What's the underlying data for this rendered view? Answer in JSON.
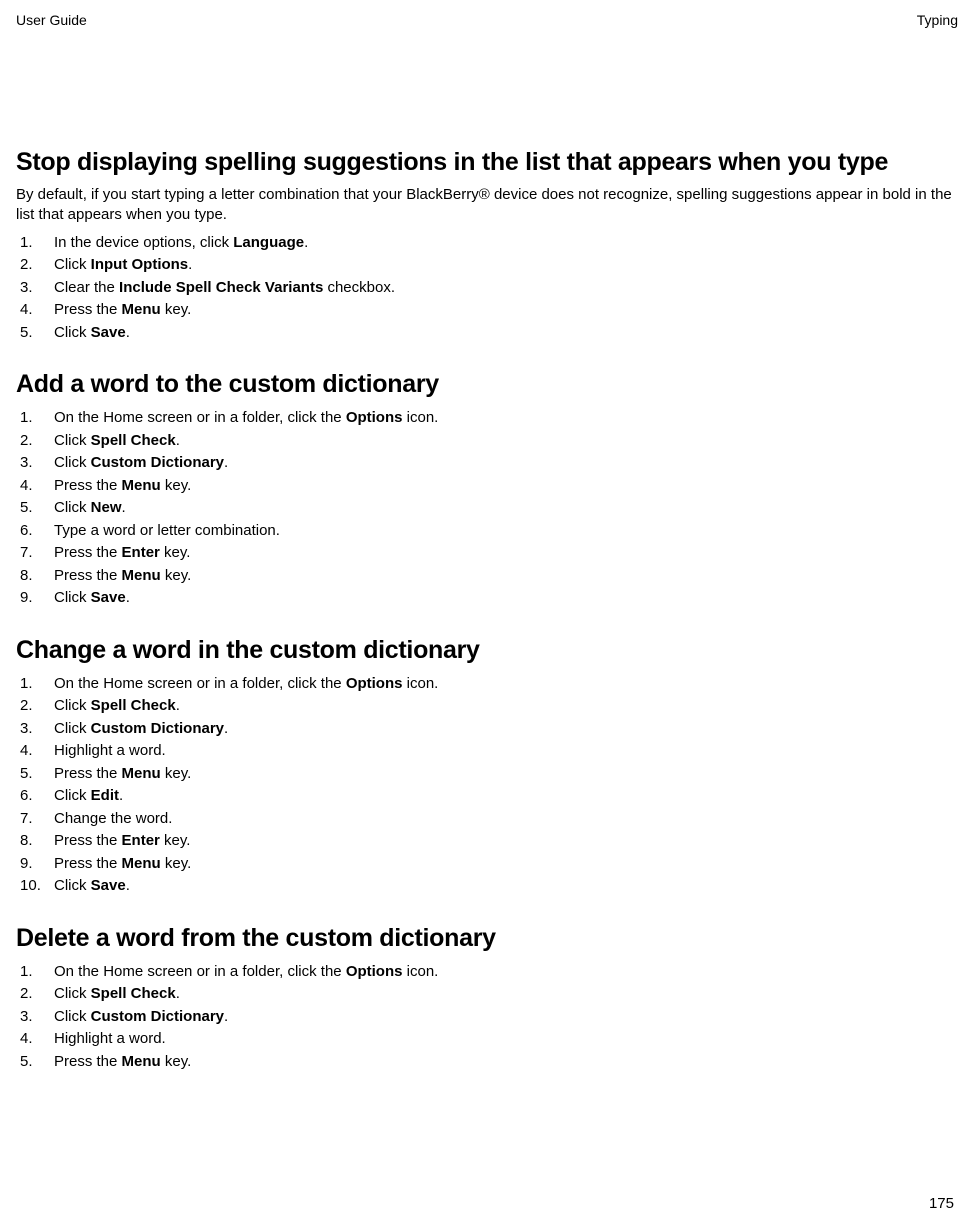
{
  "header": {
    "left": "User Guide",
    "right": "Typing"
  },
  "sections": [
    {
      "title": "Stop displaying spelling suggestions in the list that appears when you type",
      "intro": "By default, if you start typing a letter combination that your BlackBerry® device does not recognize, spelling suggestions appear in bold in the list that appears when you type.",
      "steps": [
        [
          {
            "t": "In the device options, click "
          },
          {
            "b": "Language"
          },
          {
            "t": "."
          }
        ],
        [
          {
            "t": "Click "
          },
          {
            "b": "Input Options"
          },
          {
            "t": "."
          }
        ],
        [
          {
            "t": "Clear the "
          },
          {
            "b": "Include Spell Check Variants"
          },
          {
            "t": " checkbox."
          }
        ],
        [
          {
            "t": "Press the "
          },
          {
            "b": "Menu"
          },
          {
            "t": " key."
          }
        ],
        [
          {
            "t": "Click "
          },
          {
            "b": "Save"
          },
          {
            "t": "."
          }
        ]
      ]
    },
    {
      "title": "Add a word to the custom dictionary",
      "steps": [
        [
          {
            "t": "On the Home screen or in a folder, click the "
          },
          {
            "b": "Options"
          },
          {
            "t": " icon."
          }
        ],
        [
          {
            "t": "Click "
          },
          {
            "b": "Spell Check"
          },
          {
            "t": "."
          }
        ],
        [
          {
            "t": "Click "
          },
          {
            "b": "Custom Dictionary"
          },
          {
            "t": "."
          }
        ],
        [
          {
            "t": "Press the "
          },
          {
            "b": "Menu"
          },
          {
            "t": " key."
          }
        ],
        [
          {
            "t": "Click "
          },
          {
            "b": "New"
          },
          {
            "t": "."
          }
        ],
        [
          {
            "t": "Type a word or letter combination."
          }
        ],
        [
          {
            "t": "Press the "
          },
          {
            "b": "Enter"
          },
          {
            "t": " key."
          }
        ],
        [
          {
            "t": "Press the "
          },
          {
            "b": "Menu"
          },
          {
            "t": " key."
          }
        ],
        [
          {
            "t": "Click "
          },
          {
            "b": "Save"
          },
          {
            "t": "."
          }
        ]
      ]
    },
    {
      "title": "Change a word in the custom dictionary",
      "steps": [
        [
          {
            "t": "On the Home screen or in a folder, click the "
          },
          {
            "b": "Options"
          },
          {
            "t": " icon."
          }
        ],
        [
          {
            "t": "Click "
          },
          {
            "b": "Spell Check"
          },
          {
            "t": "."
          }
        ],
        [
          {
            "t": "Click "
          },
          {
            "b": "Custom Dictionary"
          },
          {
            "t": "."
          }
        ],
        [
          {
            "t": "Highlight a word."
          }
        ],
        [
          {
            "t": "Press the "
          },
          {
            "b": "Menu"
          },
          {
            "t": " key."
          }
        ],
        [
          {
            "t": "Click "
          },
          {
            "b": "Edit"
          },
          {
            "t": "."
          }
        ],
        [
          {
            "t": "Change the word."
          }
        ],
        [
          {
            "t": "Press the "
          },
          {
            "b": "Enter"
          },
          {
            "t": " key."
          }
        ],
        [
          {
            "t": "Press the "
          },
          {
            "b": "Menu"
          },
          {
            "t": " key."
          }
        ],
        [
          {
            "t": "Click "
          },
          {
            "b": "Save"
          },
          {
            "t": "."
          }
        ]
      ]
    },
    {
      "title": "Delete a word from the custom dictionary",
      "steps": [
        [
          {
            "t": "On the Home screen or in a folder, click the "
          },
          {
            "b": "Options"
          },
          {
            "t": " icon."
          }
        ],
        [
          {
            "t": "Click "
          },
          {
            "b": "Spell Check"
          },
          {
            "t": "."
          }
        ],
        [
          {
            "t": "Click "
          },
          {
            "b": "Custom Dictionary"
          },
          {
            "t": "."
          }
        ],
        [
          {
            "t": "Highlight a word."
          }
        ],
        [
          {
            "t": "Press the "
          },
          {
            "b": "Menu"
          },
          {
            "t": " key."
          }
        ]
      ]
    }
  ],
  "page_number": "175"
}
